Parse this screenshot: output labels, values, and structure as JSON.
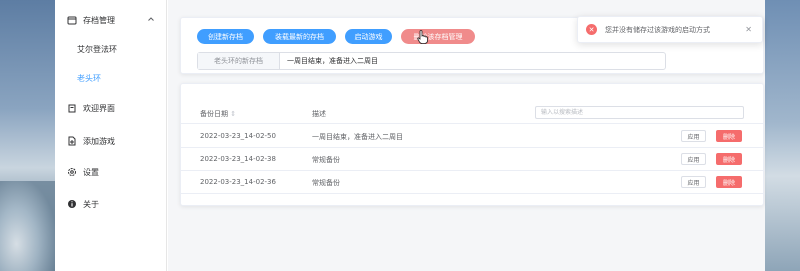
{
  "sidebar": {
    "group": {
      "label": "存档管理",
      "icon": "archive-icon",
      "expanded": true
    },
    "games": [
      {
        "label": "艾尔登法环"
      },
      {
        "label": "老头环",
        "active": true
      }
    ],
    "items": [
      {
        "label": "欢迎界面",
        "icon": "home-icon"
      },
      {
        "label": "添加游戏",
        "icon": "add-file-icon"
      },
      {
        "label": "设置",
        "icon": "gear-icon"
      },
      {
        "label": "关于",
        "icon": "info-icon"
      }
    ]
  },
  "toolbar": {
    "create_label": "创建新存档",
    "load_label": "装载最新的存档",
    "launch_label": "启动游戏",
    "delete_label": "删除该存档管理"
  },
  "new_save": {
    "prepend": "老头环的新存档",
    "value": "一周目结束，准备进入二周目"
  },
  "table": {
    "col_date": "备份日期",
    "col_desc": "描述",
    "search_placeholder": "输入以搜索描述",
    "apply_label": "应用",
    "delete_label": "删除",
    "rows": [
      {
        "date": "2022-03-23_14-02-50",
        "desc": "一周目结束，准备进入二周目"
      },
      {
        "date": "2022-03-23_14-02-38",
        "desc": "常规备份"
      },
      {
        "date": "2022-03-23_14-02-36",
        "desc": "常规备份"
      }
    ]
  },
  "toast": {
    "message": "您并没有储存过该游戏的启动方式",
    "type": "error"
  },
  "colors": {
    "primary": "#409eff",
    "danger": "#f56c6c",
    "danger_light": "#f08b8b"
  }
}
